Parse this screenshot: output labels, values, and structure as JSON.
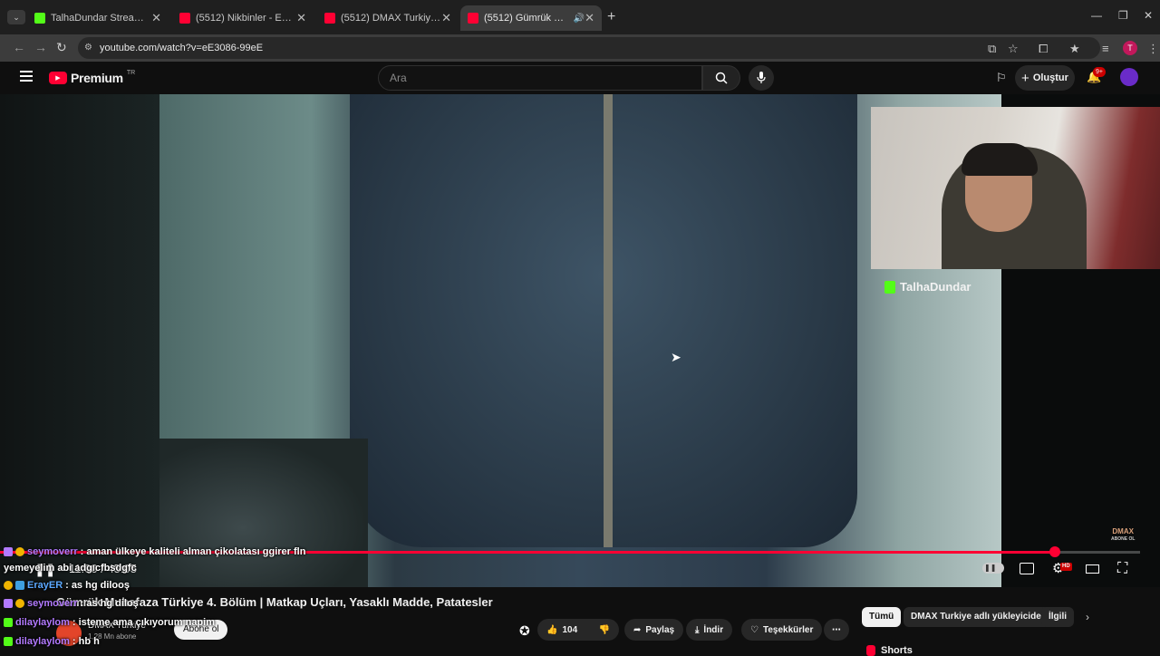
{
  "browser": {
    "tabs": [
      {
        "title": "TalhaDundar Stream - Kick Dashboard",
        "favicon_color": "#53fc18",
        "active": false
      },
      {
        "title": "(5512) Nikbinler - Eylülzede | 7...",
        "favicon_color": "#ff0033",
        "active": false
      },
      {
        "title": "(5512) DMAX Turkiye - YouTube",
        "favicon_color": "#ff0033",
        "active": false
      },
      {
        "title": "(5512) Gümrük Muhafaza Türkiye",
        "favicon_color": "#ff0033",
        "active": true
      }
    ],
    "url": "youtube.com/watch?v=eE3086-99eE",
    "profile_initial": "T"
  },
  "youtube": {
    "logo_text": "Premium",
    "logo_superscript": "TR",
    "search_placeholder": "Ara",
    "create_label": "Oluştur",
    "notification_count": "9+"
  },
  "video": {
    "streamer_name": "TalhaDundar",
    "watermark": {
      "line1": "DMAX",
      "line2": "ABONE OL"
    },
    "current_time": "11:00",
    "duration": "45:05",
    "progress_fraction": 0.925,
    "quality_badge": "HD",
    "accent_color": "#ff0033"
  },
  "chat": [
    {
      "user": "seymoverr",
      "message": "aman ülkeye kaliteli alman çikolatası ggirer fln",
      "user_color": "#b27aff"
    },
    {
      "user": "",
      "message": "yemeyelim abi adgıcfbsdgfc",
      "user_color": "#ffffff"
    },
    {
      "user": "ErayER",
      "message": "as hg dilooş",
      "user_color": "#5ba8ff"
    },
    {
      "user": "seymoverr",
      "message": "as hg diloş",
      "user_color": "#b27aff"
    },
    {
      "user": "dilaylaylom",
      "message": "isteme ama çıkıyorum napim",
      "user_color": "#b27aff"
    },
    {
      "user": "dilaylaylom",
      "message": "hb h",
      "user_color": "#b27aff"
    }
  ],
  "below": {
    "title": "Gümrük Muhafaza Türkiye 4. Bölüm | Matkap Uçları, Yasaklı Madde, Patatesler",
    "channel_name": "DMAX Turkiye",
    "subscribers": "1,28 Mn abone",
    "subscribe_label": "Abone ol",
    "like_count": "104",
    "share_label": "Paylaş",
    "download_label": "İndir",
    "thanks_label": "Teşekkürler",
    "chips": [
      "Tümü",
      "DMAX Turkiye adlı yükleyiciden",
      "İlgili"
    ],
    "shorts_label": "Shorts"
  }
}
